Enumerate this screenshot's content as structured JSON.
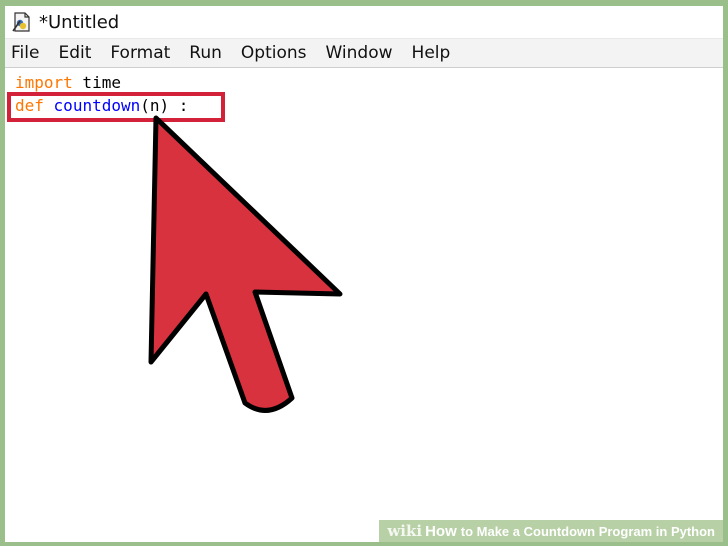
{
  "window": {
    "title": "*Untitled"
  },
  "menu": {
    "items": [
      "File",
      "Edit",
      "Format",
      "Run",
      "Options",
      "Window",
      "Help"
    ]
  },
  "code": {
    "line1": {
      "keyword": "import",
      "rest": " time"
    },
    "line2": {
      "keyword": "def",
      "name": "countdown",
      "rest": "(n) :"
    }
  },
  "footer": {
    "brand": "wiki",
    "how": "How",
    "title": "to Make a Countdown Program in Python"
  },
  "colors": {
    "keyword": "#ff7700",
    "function_name": "#0000ff",
    "highlight": "#d4213a",
    "arrow_fill": "#d9323f",
    "frame": "#9bbf8a"
  },
  "icons": {
    "app": "python-idle-icon",
    "pointer": "cursor-arrow-icon"
  }
}
